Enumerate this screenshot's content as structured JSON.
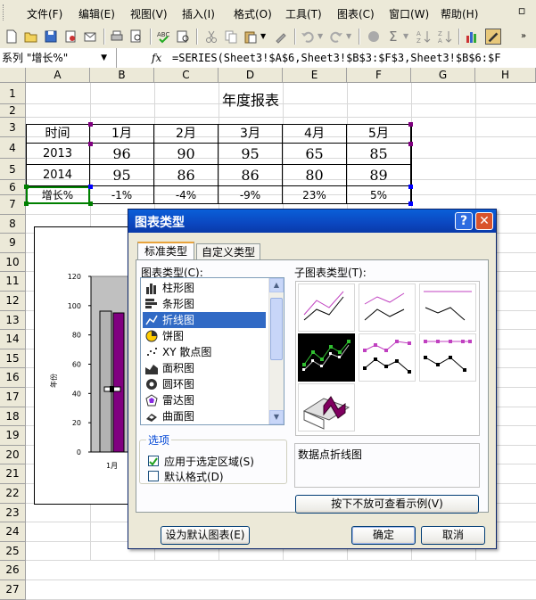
{
  "menu": {
    "items": [
      "文件(F)",
      "编辑(E)",
      "视图(V)",
      "插入(I)",
      "格式(O)",
      "工具(T)",
      "图表(C)",
      "窗口(W)",
      "帮助(H)"
    ]
  },
  "formula_bar": {
    "name_box": "系列 \"增长%\"",
    "fx": "fx",
    "formula": "=SERIES(Sheet3!$A$6,Sheet3!$B$3:$F$3,Sheet3!$B$6:$F"
  },
  "sheet": {
    "columns": [
      "A",
      "B",
      "C",
      "D",
      "E",
      "F",
      "G",
      "H"
    ],
    "rows": [
      "1",
      "2",
      "3",
      "4",
      "5",
      "6",
      "7",
      "8",
      "9",
      "10",
      "11",
      "12",
      "13",
      "14",
      "15",
      "16",
      "17",
      "18",
      "19",
      "20",
      "21",
      "22",
      "23",
      "24",
      "25",
      "26",
      "27"
    ],
    "title": "年度报表",
    "header": [
      "时间",
      "1月",
      "2月",
      "3月",
      "4月",
      "5月"
    ],
    "data": [
      [
        "2013",
        "96",
        "90",
        "95",
        "65",
        "85"
      ],
      [
        "2014",
        "95",
        "86",
        "86",
        "80",
        "89"
      ],
      [
        "增长%",
        "-1%",
        "-4%",
        "-9%",
        "23%",
        "5%"
      ]
    ]
  },
  "embedded_chart": {
    "y_ticks": [
      "120",
      "100",
      "80",
      "60",
      "40",
      "20",
      "0"
    ],
    "y_axis_label": "年份",
    "x_first_label": "1月"
  },
  "dialog": {
    "title": "图表类型",
    "help_button": "?",
    "close_button": "✕",
    "tabs": [
      "标准类型",
      "自定义类型"
    ],
    "chart_type_label": "图表类型(C):",
    "subtype_label": "子图表类型(T):",
    "chart_types": [
      {
        "label": "柱形图",
        "icon": "column-chart-icon"
      },
      {
        "label": "条形图",
        "icon": "bar-chart-icon"
      },
      {
        "label": "折线图",
        "icon": "line-chart-icon"
      },
      {
        "label": "饼图",
        "icon": "pie-chart-icon"
      },
      {
        "label": "XY 散点图",
        "icon": "scatter-chart-icon"
      },
      {
        "label": "面积图",
        "icon": "area-chart-icon"
      },
      {
        "label": "圆环图",
        "icon": "doughnut-chart-icon"
      },
      {
        "label": "雷达图",
        "icon": "radar-chart-icon"
      },
      {
        "label": "曲面图",
        "icon": "surface-chart-icon"
      }
    ],
    "selected_index": 2,
    "options_label": "选项",
    "option_apply": "应用于选定区域(S)",
    "option_default_format": "默认格式(D)",
    "option_apply_checked": true,
    "option_default_format_checked": false,
    "subtype_description": "数据点折线图",
    "preview_button": "按下不放可查看示例(V)",
    "set_default_button": "设为默认图表(E)",
    "ok_button": "确定",
    "cancel_button": "取消"
  },
  "colors": {
    "xp_title": "#0a47c0",
    "selection": "#316ac5",
    "range_handle_purple": "#800080",
    "range_handle_blue": "#0000ff",
    "range_handle_green": "#008000"
  }
}
